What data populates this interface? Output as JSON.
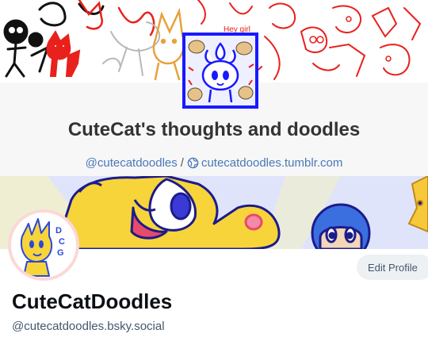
{
  "tumblr": {
    "title": "CuteCat's thoughts and doodles",
    "username": "@cutecatdoodles",
    "separator": "/",
    "url": "cutecatdoodles.tumblr.com",
    "banner_sketch_text": "Hey girl"
  },
  "bluesky": {
    "display_name": "CuteCatDoodles",
    "handle": "@cutecatdoodles.bsky.social",
    "edit_profile_label": "Edit Profile",
    "avatar_letters": [
      "D",
      "C",
      "G"
    ]
  },
  "colors": {
    "link": "#4a78b5",
    "title": "#333333",
    "avatar_border": "#1919ff",
    "sketch_red": "#e8211c",
    "edit_button_bg": "#eef1f4",
    "handle": "#42576c"
  },
  "icons": [
    "globe-icon"
  ]
}
